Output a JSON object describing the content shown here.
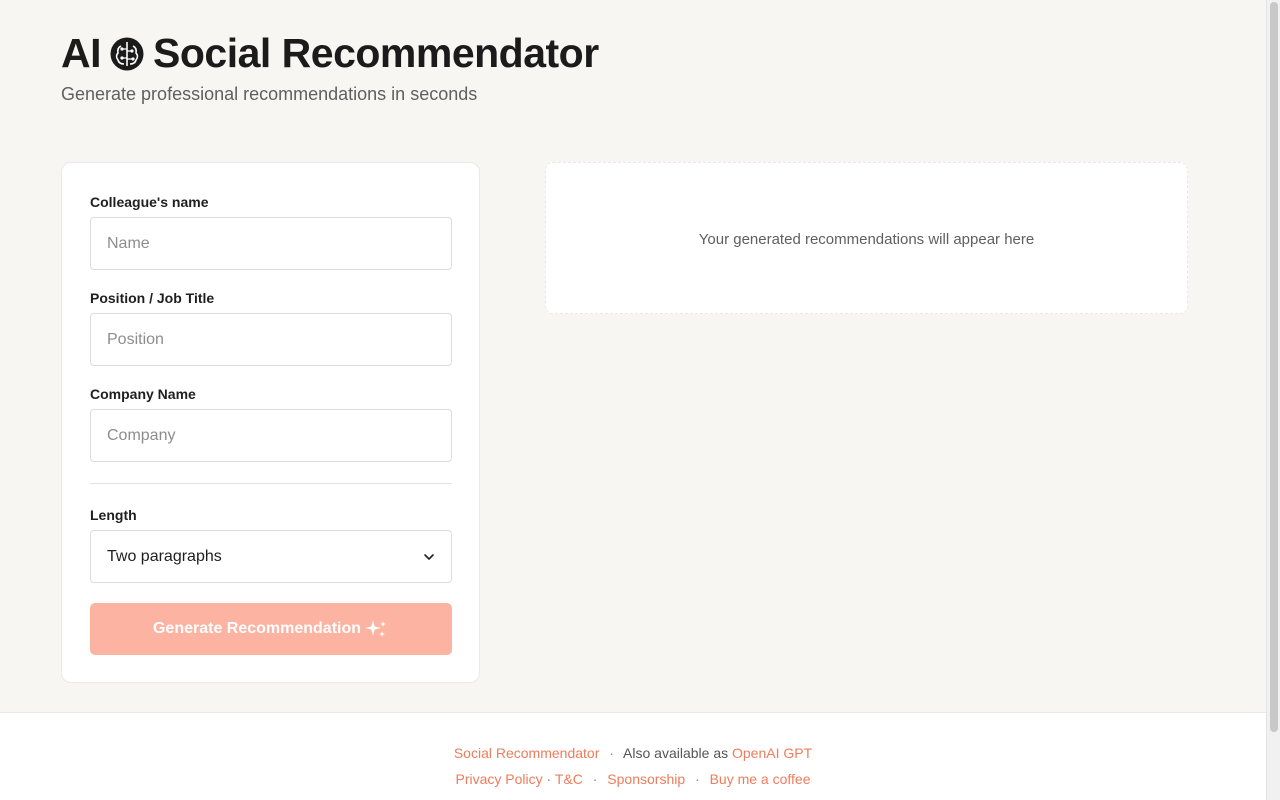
{
  "header": {
    "title_left": "AI",
    "title_right": "Social Recommendator",
    "brain_icon": "brain-icon",
    "subtitle": "Generate professional recommendations in seconds"
  },
  "form": {
    "name": {
      "label": "Colleague's name",
      "value": "",
      "placeholder": "Name"
    },
    "position": {
      "label": "Position / Job Title",
      "value": "",
      "placeholder": "Position"
    },
    "company": {
      "label": "Company Name",
      "value": "",
      "placeholder": "Company"
    },
    "length": {
      "label": "Length",
      "selected": "Two paragraphs"
    },
    "generate_label": "Generate Recommendation",
    "generate_icon": "sparkles-icon"
  },
  "output": {
    "placeholder": "Your generated recommendations will appear here"
  },
  "footer": {
    "brand_link": "Social Recommendator",
    "also_text": "Also available as",
    "gpt_link": "OpenAI GPT",
    "privacy_link": "Privacy Policy",
    "tc_link": "T&C",
    "sponsorship_link": "Sponsorship",
    "coffee_link": "Buy me a coffee"
  },
  "colors": {
    "accent": "#ef7c5c",
    "button_disabled": "#fdb3a1",
    "background": "#f7f6f3"
  }
}
